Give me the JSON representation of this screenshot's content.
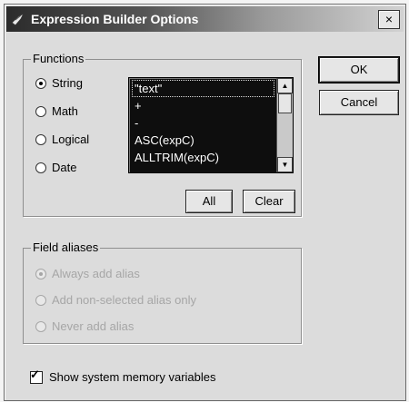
{
  "window": {
    "title": "Expression Builder Options",
    "close_glyph": "×"
  },
  "functions": {
    "label": "Functions",
    "options": [
      {
        "label": "String",
        "checked": true
      },
      {
        "label": "Math",
        "checked": false
      },
      {
        "label": "Logical",
        "checked": false
      },
      {
        "label": "Date",
        "checked": false
      }
    ],
    "list": [
      "\"text\"",
      "+",
      "-",
      "ASC(expC)",
      "ALLTRIM(expC)"
    ],
    "selected_index": 0,
    "buttons": {
      "all": "All",
      "clear": "Clear"
    }
  },
  "dialog_buttons": {
    "ok": "OK",
    "cancel": "Cancel"
  },
  "field_aliases": {
    "label": "Field aliases",
    "enabled": false,
    "options": [
      {
        "label": "Always add alias",
        "checked": true
      },
      {
        "label": "Add non-selected alias only",
        "checked": false
      },
      {
        "label": "Never add alias",
        "checked": false
      }
    ]
  },
  "show_system_memory_variables": {
    "label": "Show system memory variables",
    "checked": true,
    "mark": "✓"
  },
  "icons": {
    "up": "▲",
    "down": "▼"
  }
}
